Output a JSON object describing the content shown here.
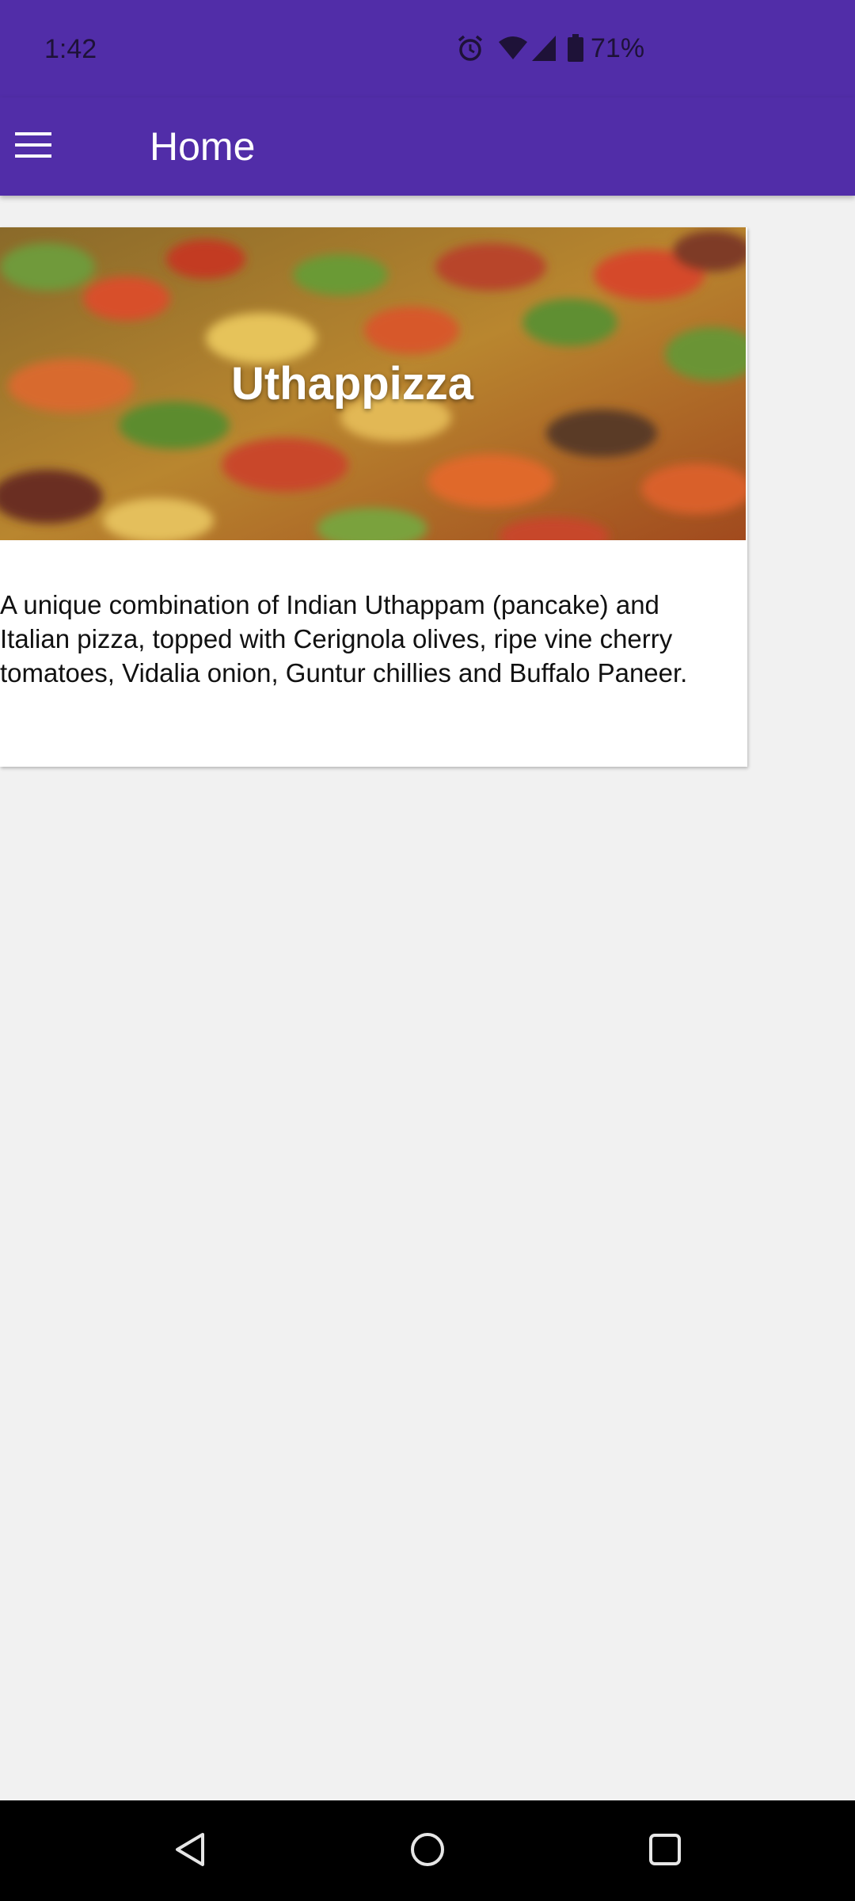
{
  "status_bar": {
    "time": "1:42",
    "battery_percent": "71%",
    "icons": [
      "alarm-icon",
      "wifi-icon",
      "signal-icon",
      "battery-icon"
    ]
  },
  "app_bar": {
    "title": "Home",
    "menu_icon": "hamburger-menu-icon",
    "background_color": "#512da8"
  },
  "card": {
    "title": "Uthappizza",
    "description": "A unique combination of Indian Uthappam (pancake) and Italian pizza, topped with Cerignola olives, ripe vine cherry tomatoes, Vidalia onion, Guntur chillies and Buffalo Paneer."
  },
  "nav_bar": {
    "buttons": [
      "back-icon",
      "home-icon",
      "recents-icon"
    ]
  }
}
